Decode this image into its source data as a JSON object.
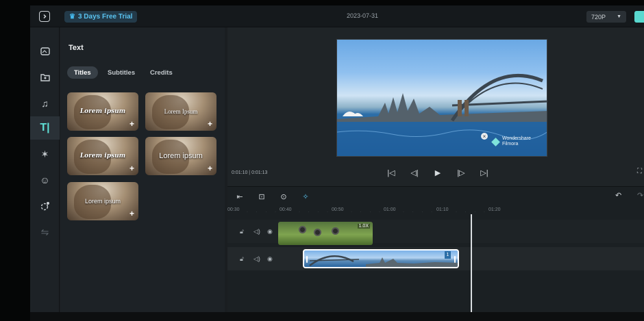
{
  "topbar": {
    "trial_label": "3 Days Free Trial",
    "project_date": "2023-07-31",
    "resolution": "720P",
    "resolution_caret": "▼"
  },
  "rail": {
    "items": [
      {
        "icon": "media-icon"
      },
      {
        "icon": "stock-media-icon"
      },
      {
        "icon": "audio-icon"
      },
      {
        "icon": "text-icon",
        "glyph": "T|"
      },
      {
        "icon": "effects-icon"
      },
      {
        "icon": "stickers-icon"
      },
      {
        "icon": "transitions-icon"
      },
      {
        "icon": "more-icon"
      }
    ]
  },
  "panel": {
    "title": "Text",
    "tabs": [
      "Titles",
      "Subtitles",
      "Credits"
    ],
    "active_tab": "Titles",
    "thumbnails": [
      {
        "caption": "Lorem ipsum",
        "style": "script"
      },
      {
        "caption": "Lorem Ipsum",
        "style": "serif"
      },
      {
        "caption": "Lorem ipsum",
        "style": "script"
      },
      {
        "caption": "Lorem ipsum",
        "style": "sans"
      },
      {
        "caption": "Lorem ipsum",
        "style": "sans"
      }
    ],
    "add_glyph": "+"
  },
  "preview": {
    "watermark_line1": "Wondershare",
    "watermark_line2": "Filmora",
    "timecode": "0:01:10 | 0:01:13",
    "controls": [
      "skip-start-icon",
      "prev-frame-icon",
      "play-icon",
      "next-frame-icon",
      "skip-end-icon"
    ]
  },
  "timeline": {
    "ruler": [
      "00:30",
      "00:40",
      "00:50",
      "01:00",
      "01:10",
      "01:20"
    ],
    "clip1_speed": "1.0X",
    "clip2_badge": "1"
  },
  "colors": {
    "accent": "#5fe0d6",
    "trial_text": "#59c2ef",
    "export_button": "#59d8cf",
    "app_bg": "#1a1e21"
  }
}
